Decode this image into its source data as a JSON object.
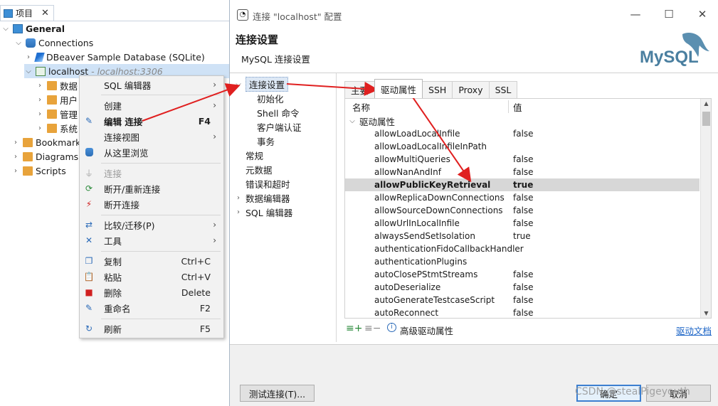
{
  "project_panel": {
    "tab_label": "项目",
    "tree": {
      "general": "General",
      "connections": "Connections",
      "sample_db": "DBeaver Sample Database (SQLite)",
      "localhost": "localhost",
      "localhost_detail": "- localhost:3306",
      "children": [
        "数据",
        "用户",
        "管理",
        "系统"
      ],
      "bookmarks": "Bookmark",
      "diagrams": "Diagrams",
      "scripts": "Scripts"
    }
  },
  "context_menu": {
    "items": [
      {
        "label": "SQL 编辑器",
        "submenu": true
      },
      {
        "label": "创建",
        "submenu": true
      },
      {
        "label": "编辑 连接",
        "key": "F4"
      },
      {
        "label": "连接视图",
        "submenu": true
      },
      {
        "label": "从这里浏览"
      },
      {
        "label": "连接"
      },
      {
        "label": "断开/重新连接"
      },
      {
        "label": "断开连接"
      },
      {
        "label": "比较/迁移(P)",
        "submenu": true
      },
      {
        "label": "工具",
        "submenu": true
      },
      {
        "label": "复制",
        "key": "Ctrl+C"
      },
      {
        "label": "粘贴",
        "key": "Ctrl+V"
      },
      {
        "label": "删除",
        "key": "Delete"
      },
      {
        "label": "重命名",
        "key": "F2"
      },
      {
        "label": "刷新",
        "key": "F5"
      }
    ]
  },
  "dialog": {
    "title": "连接 \"localhost\" 配置",
    "header_title": "连接设置",
    "header_subtitle": "MySQL 连接设置",
    "logo_text": "MySQL",
    "nav": {
      "conn_settings": "连接设置",
      "sub_items": [
        "初始化",
        "Shell 命令",
        "客户端认证",
        "事务"
      ],
      "items": [
        "常规",
        "元数据",
        "错误和超时",
        "数据编辑器",
        "SQL 编辑器"
      ]
    },
    "tabs": [
      "主要",
      "驱动属性",
      "SSH",
      "Proxy",
      "SSL"
    ],
    "table": {
      "col_name": "名称",
      "col_value": "值",
      "group": "驱动属性",
      "rows": [
        {
          "name": "allowLoadLocalInfile",
          "value": "false"
        },
        {
          "name": "allowLoadLocalInfileInPath",
          "value": ""
        },
        {
          "name": "allowMultiQueries",
          "value": "false"
        },
        {
          "name": "allowNanAndInf",
          "value": "false"
        },
        {
          "name": "allowPublicKeyRetrieval",
          "value": "true"
        },
        {
          "name": "allowReplicaDownConnections",
          "value": "false"
        },
        {
          "name": "allowSourceDownConnections",
          "value": "false"
        },
        {
          "name": "allowUrlInLocalInfile",
          "value": "false"
        },
        {
          "name": "alwaysSendSetIsolation",
          "value": "true"
        },
        {
          "name": "authenticationFidoCallbackHandler",
          "value": ""
        },
        {
          "name": "authenticationPlugins",
          "value": ""
        },
        {
          "name": "autoClosePStmtStreams",
          "value": "false"
        },
        {
          "name": "autoDeserialize",
          "value": "false"
        },
        {
          "name": "autoGenerateTestcaseScript",
          "value": "false"
        },
        {
          "name": "autoReconnect",
          "value": "false"
        }
      ]
    },
    "advanced_props": "高级驱动属性",
    "driver_docs_link": "驱动文档",
    "buttons": {
      "test": "测试连接(T)...",
      "ok": "确定",
      "cancel": "取消"
    }
  },
  "watermark": "CSDN @stealPigeyouth",
  "colors": {
    "selection": "#cfe2f6",
    "highlight_row": "#d7d7d7",
    "arrow": "#e02020",
    "link": "#1a63c6"
  }
}
